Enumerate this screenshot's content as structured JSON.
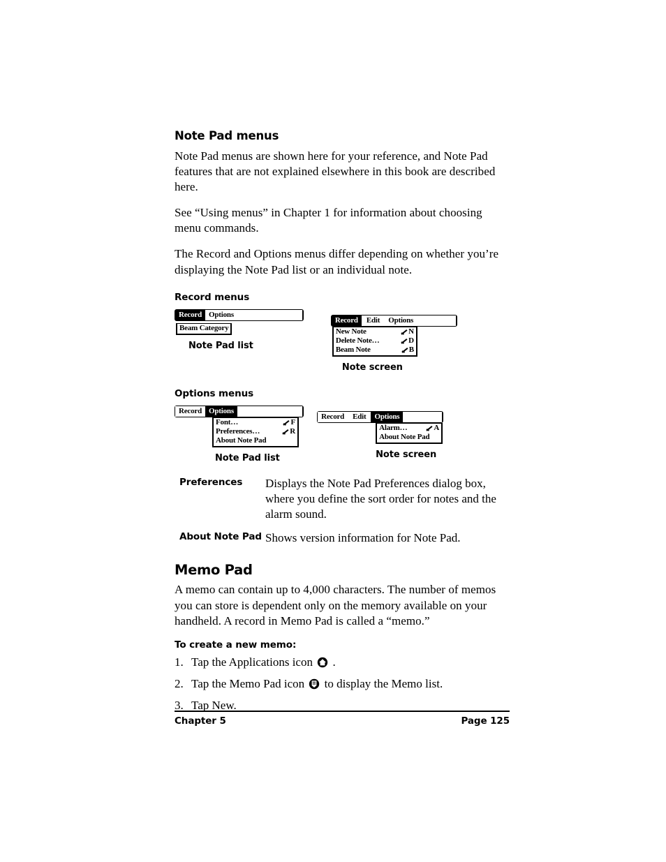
{
  "section_note_pad_menus": {
    "heading": "Note Pad menus",
    "paragraphs": [
      "Note Pad menus are shown here for your reference, and Note Pad features that are not explained elsewhere in this book are described here.",
      "See “Using menus” in Chapter 1 for information about choosing menu commands.",
      "The Record and Options menus differ depending on whether you’re displaying the Note Pad list or an individual note."
    ]
  },
  "record_menus": {
    "heading": "Record menus",
    "list_menu": {
      "menubar": [
        {
          "label": "Record",
          "selected": true
        },
        {
          "label": "Options",
          "selected": false
        }
      ],
      "items": [
        {
          "label": "Beam Category",
          "shortcut": ""
        }
      ],
      "caption": "Note Pad list"
    },
    "note_menu": {
      "menubar": [
        {
          "label": "Record",
          "selected": true
        },
        {
          "label": "Edit",
          "selected": false
        },
        {
          "label": "Options",
          "selected": false
        }
      ],
      "items": [
        {
          "label": "New Note",
          "shortcut": "N"
        },
        {
          "label": "Delete Note…",
          "shortcut": "D"
        },
        {
          "label": "Beam Note",
          "shortcut": "B"
        }
      ],
      "caption": "Note screen"
    }
  },
  "options_menus": {
    "heading": "Options menus",
    "list_menu": {
      "menubar": [
        {
          "label": "Record",
          "selected": false
        },
        {
          "label": "Options",
          "selected": true
        }
      ],
      "items": [
        {
          "label": "Font…",
          "shortcut": "F"
        },
        {
          "label": "Preferences…",
          "shortcut": "R"
        },
        {
          "label": "About Note Pad",
          "shortcut": ""
        }
      ],
      "caption": "Note Pad list"
    },
    "note_menu": {
      "menubar": [
        {
          "label": "Record",
          "selected": false
        },
        {
          "label": "Edit",
          "selected": false
        },
        {
          "label": "Options",
          "selected": true
        }
      ],
      "items": [
        {
          "label": "Alarm…",
          "shortcut": "A"
        },
        {
          "label": "About Note Pad",
          "shortcut": ""
        }
      ],
      "caption": "Note screen"
    },
    "definitions": [
      {
        "term": "Preferences",
        "description": "Displays the Note Pad Preferences dialog box, where you define the sort order for notes and the alarm sound."
      },
      {
        "term": "About Note Pad",
        "description": "Shows version information for Note Pad."
      }
    ]
  },
  "memo_pad": {
    "heading": "Memo Pad",
    "intro": "A memo can contain up to 4,000 characters. The number of memos you can store is dependent only on the memory available on your handheld. A record in Memo Pad is called a “memo.”",
    "subheading": "To create a new memo:",
    "steps": [
      {
        "num": "1.",
        "before": "Tap the Applications icon",
        "icon": "applications-icon",
        "after": "."
      },
      {
        "num": "2.",
        "before": "Tap the Memo Pad icon",
        "icon": "memo-pad-icon",
        "after": "to display the Memo list."
      },
      {
        "num": "3.",
        "before": "Tap New.",
        "icon": "",
        "after": ""
      }
    ]
  },
  "footer": {
    "left": "Chapter 5",
    "right": "Page 125"
  },
  "colors": {
    "text": "#000000",
    "background": "#ffffff",
    "menu_chrome": "#000000"
  }
}
